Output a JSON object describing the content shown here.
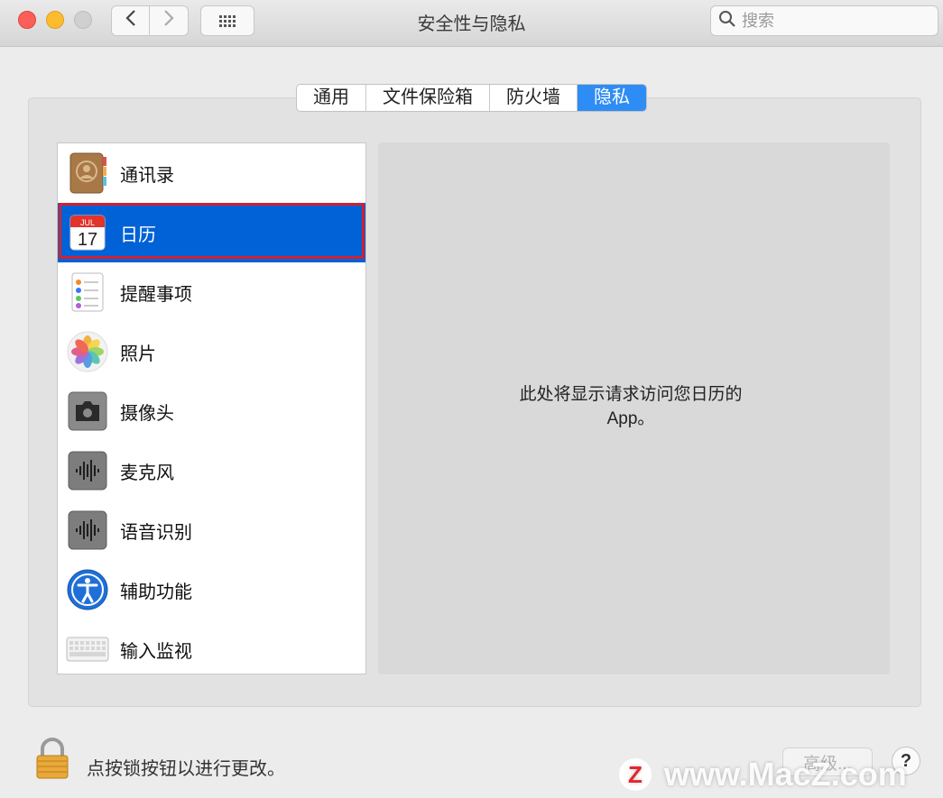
{
  "window": {
    "title": "安全性与隐私",
    "search_placeholder": "搜索"
  },
  "tabs": [
    {
      "label": "通用",
      "active": false
    },
    {
      "label": "文件保险箱",
      "active": false
    },
    {
      "label": "防火墙",
      "active": false
    },
    {
      "label": "隐私",
      "active": true
    }
  ],
  "sidebar": {
    "items": [
      {
        "label": "通讯录",
        "icon": "contacts-icon",
        "selected": false
      },
      {
        "label": "日历",
        "icon": "calendar-icon",
        "selected": true
      },
      {
        "label": "提醒事项",
        "icon": "reminders-icon",
        "selected": false
      },
      {
        "label": "照片",
        "icon": "photos-icon",
        "selected": false
      },
      {
        "label": "摄像头",
        "icon": "camera-icon",
        "selected": false
      },
      {
        "label": "麦克风",
        "icon": "microphone-icon",
        "selected": false
      },
      {
        "label": "语音识别",
        "icon": "speech-recognition-icon",
        "selected": false
      },
      {
        "label": "辅助功能",
        "icon": "accessibility-icon",
        "selected": false
      },
      {
        "label": "输入监视",
        "icon": "keyboard-icon",
        "selected": false
      }
    ]
  },
  "calendar_icon": {
    "month": "JUL",
    "day": "17"
  },
  "detail": {
    "message": "此处将显示请求访问您日历的App。"
  },
  "footer": {
    "lock_text": "点按锁按钮以进行更改。",
    "advanced_label": "高级...",
    "help_label": "?"
  },
  "watermark": {
    "badge": "Z",
    "text": "www.MacZ.com"
  },
  "colors": {
    "accent": "#2e8cf5",
    "selection": "#0062d6",
    "highlight_border": "#d22030"
  }
}
